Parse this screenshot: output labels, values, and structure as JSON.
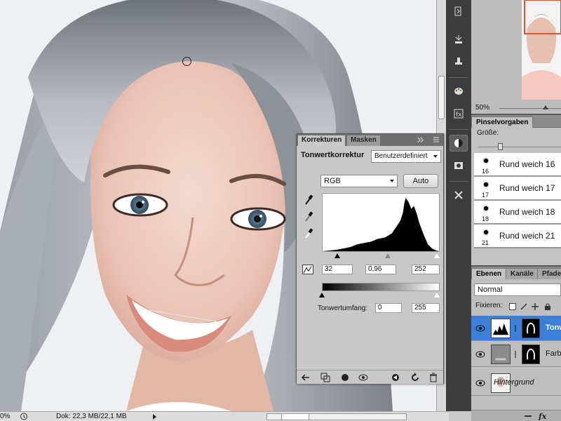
{
  "status": {
    "zoom": "0%",
    "doc": "Dok: 22,3 MB/22,1 MB"
  },
  "navigator": {
    "zoom": "50%"
  },
  "brush_panel": {
    "tab": "Pinselvorgaben",
    "size_label": "Größe:",
    "items": [
      {
        "name": "Rund weich 16",
        "num": "16"
      },
      {
        "name": "Rund weich 17",
        "num": "17"
      },
      {
        "name": "Rund weich 18",
        "num": "18"
      },
      {
        "name": "Rund weich 21",
        "num": "21"
      }
    ]
  },
  "layers_panel": {
    "tabs": [
      "Ebenen",
      "Kanäle",
      "Pfade"
    ],
    "blend_mode": "Normal",
    "lock_label": "Fixieren:",
    "layers": [
      {
        "name": "Tonw",
        "selected": true
      },
      {
        "name": "Farb",
        "selected": false
      },
      {
        "name": "Hintergrund",
        "selected": false
      }
    ]
  },
  "korrekturen": {
    "tabs": [
      "Korrekturen",
      "Masken"
    ],
    "title": "Tonwertkorrektur",
    "preset": "Benutzerdefiniert",
    "channel": "RGB",
    "auto_label": "Auto",
    "input_black": "32",
    "input_gamma": "0,96",
    "input_white": "252",
    "output_label": "Tonwertumfang:",
    "output_black": "0",
    "output_white": "255"
  },
  "icons": {
    "picker_black": "eyedropper-black-icon",
    "picker_gray": "eyedropper-gray-icon",
    "picker_white": "eyedropper-white-icon"
  },
  "colors": {
    "selection_blue": "#3b7fd9",
    "panel_gray": "#c8c8c8",
    "dark_strip": "#3c3c3c"
  }
}
